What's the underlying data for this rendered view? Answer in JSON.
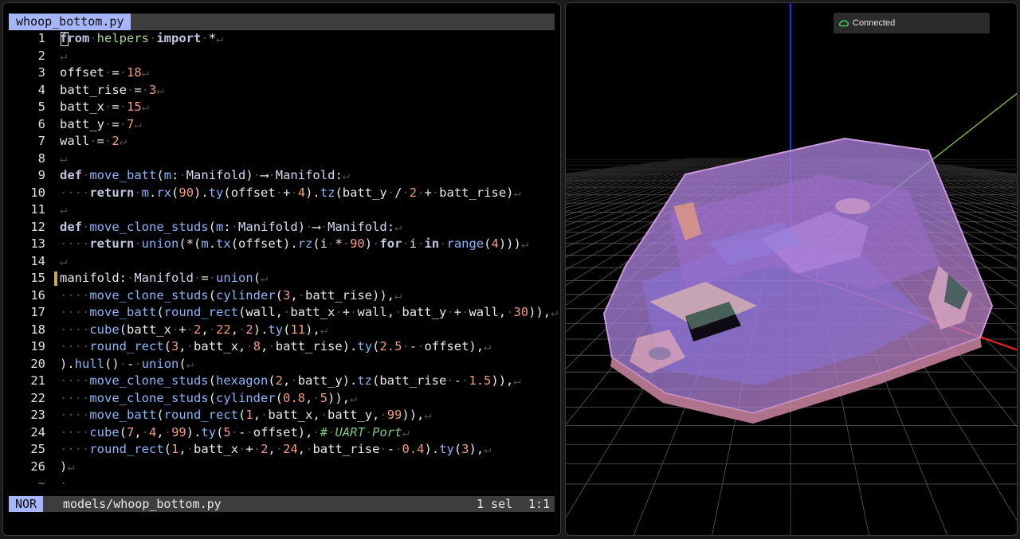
{
  "editor": {
    "tab_title": "whoop_bottom.py",
    "lines": [
      {
        "num": "1",
        "html": "<span class=\"kw2\">from</span><span class=\"dim\">·</span><span class=\"str\">helpers</span><span class=\"dim\">·</span><span class=\"kw2\">import</span><span class=\"dim\">·</span>*<span class=\"dim\">↵</span>"
      },
      {
        "num": "2",
        "html": "<span class=\"dim\">↵</span>"
      },
      {
        "num": "3",
        "html": "offset<span class=\"dim\">·</span>=<span class=\"dim\">·</span><span class=\"num\">18</span><span class=\"dim\">↵</span>"
      },
      {
        "num": "4",
        "html": "batt_rise<span class=\"dim\">·</span>=<span class=\"dim\">·</span><span class=\"num\">3</span><span class=\"dim\">↵</span>"
      },
      {
        "num": "5",
        "html": "batt_x<span class=\"dim\">·</span>=<span class=\"dim\">·</span><span class=\"num\">15</span><span class=\"dim\">↵</span>"
      },
      {
        "num": "6",
        "html": "batt_y<span class=\"dim\">·</span>=<span class=\"dim\">·</span><span class=\"num\">7</span><span class=\"dim\">↵</span>"
      },
      {
        "num": "7",
        "html": "wall<span class=\"dim\">·</span>=<span class=\"dim\">·</span><span class=\"num\">2</span><span class=\"dim\">↵</span>"
      },
      {
        "num": "8",
        "html": "<span class=\"dim\">↵</span>"
      },
      {
        "num": "9",
        "html": "<span class=\"kw2\">def</span><span class=\"dim\">·</span><span class=\"fn\">move_batt</span>(<span class=\"fn\">m</span>:<span class=\"dim\">·</span><span class=\"ty\">Manifold</span>)<span class=\"dim\">·</span>⟶<span class=\"dim\">·</span><span class=\"ty\">Manifold</span>:<span class=\"dim\">↵</span>"
      },
      {
        "num": "10",
        "html": "<span class=\"dim\">····</span><span class=\"kw2\">return</span><span class=\"dim\">·</span><span class=\"fn\">m</span>.<span class=\"fn\">rx</span>(<span class=\"num\">90</span>).<span class=\"fn\">ty</span>(offset<span class=\"dim\">·</span>+<span class=\"dim\">·</span><span class=\"num\">4</span>).<span class=\"fn\">tz</span>(batt_y<span class=\"dim\">·</span>/<span class=\"dim\">·</span><span class=\"num\">2</span><span class=\"dim\">·</span>+<span class=\"dim\">·</span>batt_rise)<span class=\"dim\">↵</span>"
      },
      {
        "num": "11",
        "html": "<span class=\"dim\">↵</span>"
      },
      {
        "num": "12",
        "html": "<span class=\"kw2\">def</span><span class=\"dim\">·</span><span class=\"fn\">move_clone_studs</span>(<span class=\"fn\">m</span>:<span class=\"dim\">·</span><span class=\"ty\">Manifold</span>)<span class=\"dim\">·</span>⟶<span class=\"dim\">·</span><span class=\"ty\">Manifold</span>:<span class=\"dim\">↵</span>"
      },
      {
        "num": "13",
        "html": "<span class=\"dim\">····</span><span class=\"kw2\">return</span><span class=\"dim\">·</span><span class=\"fn\">union</span>(*(<span class=\"fn\">m</span>.<span class=\"fn\">tx</span>(offset).<span class=\"fn\">rz</span>(i<span class=\"dim\">·</span>*<span class=\"dim\">·</span><span class=\"num\">90</span>)<span class=\"dim\">·</span><span class=\"kw2\">for</span><span class=\"dim\">·</span>i<span class=\"dim\">·</span><span class=\"kw2\">in</span><span class=\"dim\">·</span><span class=\"fn\">range</span>(<span class=\"num\">4</span>)))<span class=\"dim\">↵</span>"
      },
      {
        "num": "14",
        "html": "<span class=\"dim\">↵</span>"
      },
      {
        "num": "15",
        "html": "manifold:<span class=\"dim\">·</span><span class=\"ty\">Manifold</span><span class=\"dim\">·</span>=<span class=\"dim\">·</span><span class=\"fn\">union</span>(<span class=\"dim\">↵</span>",
        "marker": true
      },
      {
        "num": "16",
        "html": "<span class=\"dim\">····</span><span class=\"fn\">move_clone_studs</span>(<span class=\"fn\">cylinder</span>(<span class=\"num\">3</span>,<span class=\"dim\">·</span>batt_rise)),<span class=\"dim\">↵</span>"
      },
      {
        "num": "17",
        "html": "<span class=\"dim\">····</span><span class=\"fn\">move_batt</span>(<span class=\"fn\">round_rect</span>(wall,<span class=\"dim\">·</span>batt_x<span class=\"dim\">·</span>+<span class=\"dim\">·</span>wall,<span class=\"dim\">·</span>batt_y<span class=\"dim\">·</span>+<span class=\"dim\">·</span>wall,<span class=\"dim\">·</span><span class=\"num\">30</span>)),<span class=\"dim\">↵</span>"
      },
      {
        "num": "18",
        "html": "<span class=\"dim\">····</span><span class=\"fn\">cube</span>(batt_x<span class=\"dim\">·</span>+<span class=\"dim\">·</span><span class=\"num\">2</span>,<span class=\"dim\">·</span><span class=\"num\">22</span>,<span class=\"dim\">·</span><span class=\"num\">2</span>).<span class=\"fn\">ty</span>(<span class=\"num\">11</span>),<span class=\"dim\">↵</span>"
      },
      {
        "num": "19",
        "html": "<span class=\"dim\">····</span><span class=\"fn\">round_rect</span>(<span class=\"num\">3</span>,<span class=\"dim\">·</span>batt_x,<span class=\"dim\">·</span><span class=\"num\">8</span>,<span class=\"dim\">·</span>batt_rise).<span class=\"fn\">ty</span>(<span class=\"num\">2.5</span><span class=\"dim\">·</span>-<span class=\"dim\">·</span>offset),<span class=\"dim\">↵</span>"
      },
      {
        "num": "20",
        "html": ").<span class=\"fn\">hull</span>()<span class=\"dim\">·</span>-<span class=\"dim\">·</span><span class=\"fn\">union</span>(<span class=\"dim\">↵</span>"
      },
      {
        "num": "21",
        "html": "<span class=\"dim\">····</span><span class=\"fn\">move_clone_studs</span>(<span class=\"fn\">hexagon</span>(<span class=\"num\">2</span>,<span class=\"dim\">·</span>batt_y).<span class=\"fn\">tz</span>(batt_rise<span class=\"dim\">·</span>-<span class=\"dim\">·</span><span class=\"num\">1.5</span>)),<span class=\"dim\">↵</span>"
      },
      {
        "num": "22",
        "html": "<span class=\"dim\">····</span><span class=\"fn\">move_clone_studs</span>(<span class=\"fn\">cylinder</span>(<span class=\"num\">0.8</span>,<span class=\"dim\">·</span><span class=\"num\">5</span>)),<span class=\"dim\">↵</span>"
      },
      {
        "num": "23",
        "html": "<span class=\"dim\">····</span><span class=\"fn\">move_batt</span>(<span class=\"fn\">round_rect</span>(<span class=\"num\">1</span>,<span class=\"dim\">·</span>batt_x,<span class=\"dim\">·</span>batt_y,<span class=\"dim\">·</span><span class=\"num\">99</span>)),<span class=\"dim\">↵</span>"
      },
      {
        "num": "24",
        "html": "<span class=\"dim\">····</span><span class=\"fn\">cube</span>(<span class=\"num\">7</span>,<span class=\"dim\">·</span><span class=\"num\">4</span>,<span class=\"dim\">·</span><span class=\"num\">99</span>).<span class=\"fn\">ty</span>(<span class=\"num\">5</span><span class=\"dim\">·</span>-<span class=\"dim\">·</span>offset),<span class=\"dim\">·</span><span class=\"cm\">#<span class=\"dim\">·</span>UART<span class=\"dim\">·</span>Port</span><span class=\"dim\">↵</span>"
      },
      {
        "num": "25",
        "html": "<span class=\"dim\">····</span><span class=\"fn\">round_rect</span>(<span class=\"num\">1</span>,<span class=\"dim\">·</span>batt_x<span class=\"dim\">·</span>+<span class=\"dim\">·</span><span class=\"num\">2</span>,<span class=\"dim\">·</span><span class=\"num\">24</span>,<span class=\"dim\">·</span>batt_rise<span class=\"dim\">·</span>-<span class=\"dim\">·</span><span class=\"num\">0.4</span>).<span class=\"fn\">ty</span>(<span class=\"num\">3</span>),<span class=\"dim\">↵</span>"
      },
      {
        "num": "26",
        "html": ")<span class=\"dim\">↵</span>"
      },
      {
        "num": "~",
        "html": "<span class=\"dim\">·</span>",
        "tilde": true
      }
    ]
  },
  "statusbar": {
    "mode": "NOR",
    "path": "models/whoop_bottom.py",
    "selection": "1 sel",
    "position": "1:1"
  },
  "viewer": {
    "connection_status": "Connected",
    "status_icon": "cloud-icon",
    "axis_colors": {
      "x": "#ff2020",
      "y": "#7fc84a",
      "z": "#1a2cff"
    },
    "model_color": "#c08ad8"
  }
}
